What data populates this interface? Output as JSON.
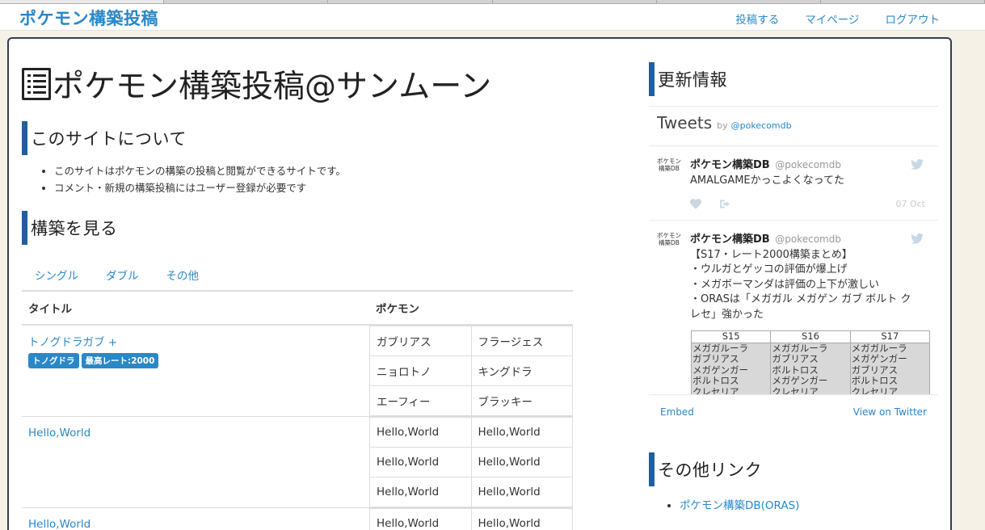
{
  "nav": {
    "brand": "ポケモン構築投稿",
    "links": [
      "投稿する",
      "マイページ",
      "ログアウト"
    ]
  },
  "main": {
    "title": "ポケモン構築投稿@サンムーン",
    "about": {
      "heading": "このサイトについて",
      "items": [
        "このサイトはポケモンの構築の投稿と閲覧ができるサイトです。",
        "コメント・新規の構築投稿にはユーザー登録が必要です"
      ]
    },
    "browse": {
      "heading": "構築を見る",
      "tabs": [
        "シングル",
        "ダブル",
        "その他"
      ],
      "columns": [
        "タイトル",
        "ポケモン"
      ],
      "rows": [
        {
          "title": "トノグドラガブ +",
          "tags": [
            "トノグドラ",
            "最高レート:2000"
          ],
          "pokemon": [
            [
              "ガブリアス",
              "フラージェス"
            ],
            [
              "ニョロトノ",
              "キングドラ"
            ],
            [
              "エーフィー",
              "ブラッキー"
            ]
          ]
        },
        {
          "title": "Hello,World",
          "tags": [],
          "pokemon": [
            [
              "Hello,World",
              "Hello,World"
            ],
            [
              "Hello,World",
              "Hello,World"
            ],
            [
              "Hello,World",
              "Hello,World"
            ]
          ]
        },
        {
          "title": "Hello,World",
          "tags": [],
          "pokemon": [
            [
              "Hello,World",
              "Hello,World"
            ]
          ]
        }
      ]
    }
  },
  "sidebar": {
    "updates_heading": "更新情報",
    "twitter": {
      "title": "Tweets",
      "by": "by",
      "handle": "@pokecomdb",
      "tweets": [
        {
          "avatar": "ポケモン構築DB",
          "name": "ポケモン構築DB",
          "handle": "@pokecomdb",
          "text": "AMALGAMEかっこよくなってた",
          "date": "07 Oct"
        },
        {
          "avatar": "ポケモン構築DB",
          "name": "ポケモン構築DB",
          "handle": "@pokecomdb",
          "lines": [
            "【S17・レート2000構築まとめ】",
            "・ウルガとゲッコの評価が爆上げ",
            "・メガボーマンダは評価の上下が激しい",
            "・ORASは「メガガル メガゲン ガブ ボルト ク",
            "レセ」強かった"
          ],
          "image_table": {
            "headers": [
              "S15",
              "S16",
              "S17"
            ],
            "rows": [
              [
                "メガガルーラ",
                "メガガルーラ",
                "メガガルーラ"
              ],
              [
                "ガブリアス",
                "ガブリアス",
                "メガゲンガー"
              ],
              [
                "メガゲンガー",
                "ボルトロス",
                "ガブリアス"
              ],
              [
                "ボルトロス",
                "メガゲンガー",
                "ボルトロス"
              ],
              [
                "クレセリア",
                "クレセリア",
                "クレセリア"
              ]
            ]
          }
        }
      ],
      "embed": "Embed",
      "view": "View on Twitter"
    },
    "links_heading": "その他リンク",
    "links": [
      "ポケモン構築DB(ORAS)"
    ]
  }
}
